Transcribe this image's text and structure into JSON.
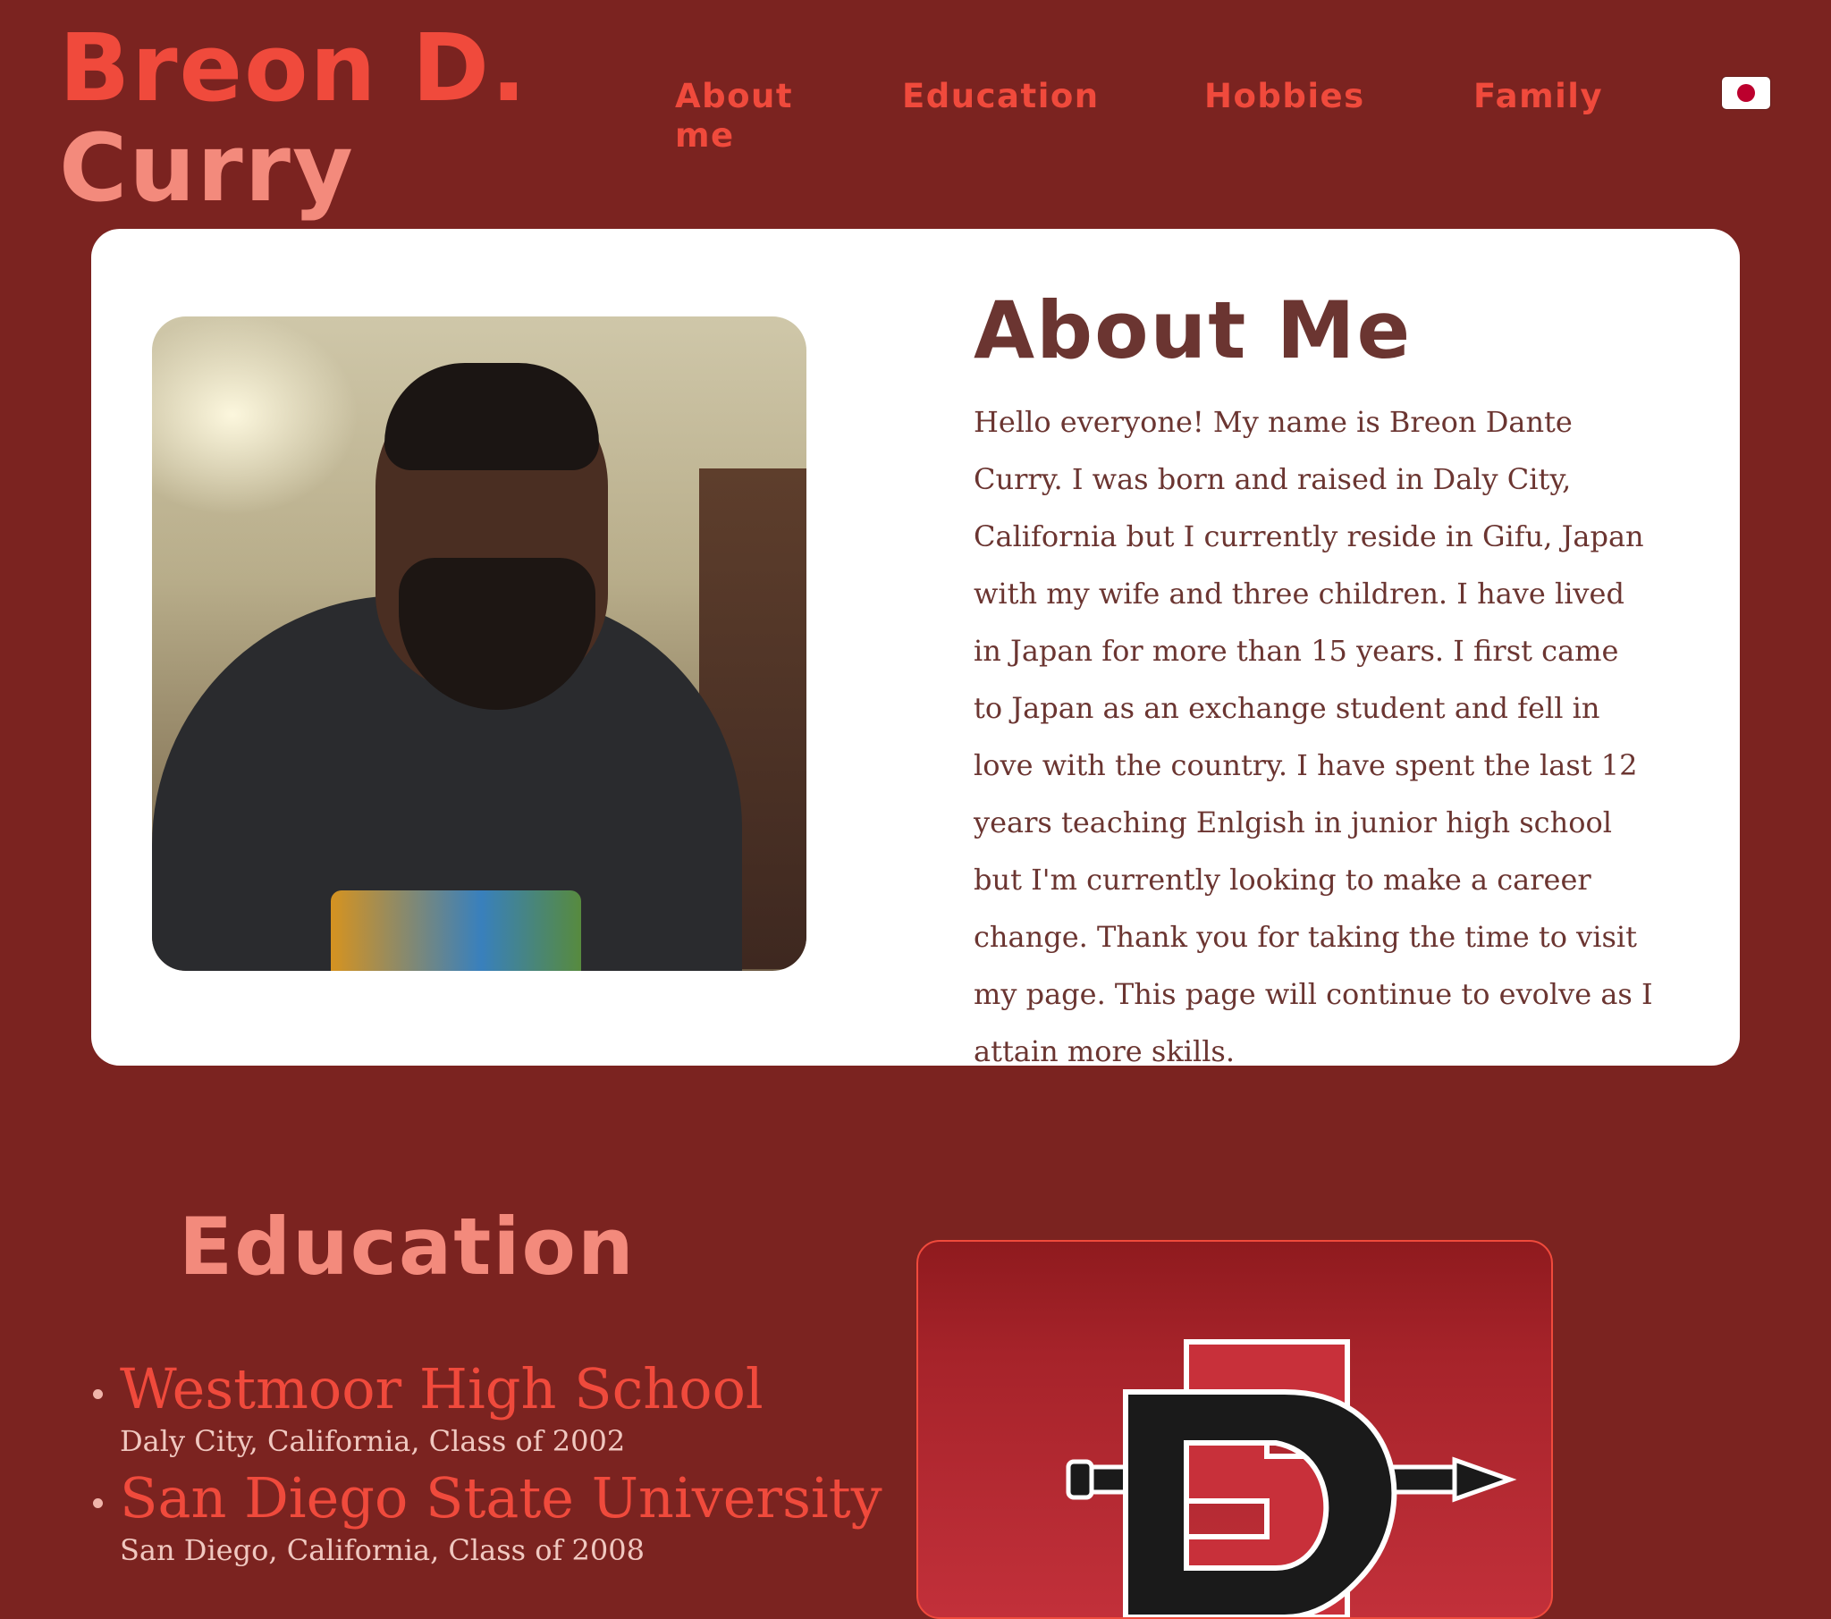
{
  "header": {
    "title_line1": "Breon D.",
    "title_line2": "Curry",
    "nav": [
      {
        "label": "About me"
      },
      {
        "label": "Education"
      },
      {
        "label": "Hobbies"
      },
      {
        "label": "Family"
      }
    ],
    "language_toggle_icon": "japan-flag-icon"
  },
  "about": {
    "heading": "About Me",
    "photo_icon": "profile-photo",
    "paragraph": "Hello everyone! My name is Breon Dante Curry. I was born and raised in Daly City, California but I currently reside in Gifu, Japan with my wife and three children. I have lived in Japan for more than 15 years. I first came to Japan as an exchange student and fell in love with the country. I have spent the last 12 years teaching Enlgish in junior high school but I'm currently looking to make a career change. Thank you for taking the time to visit my page. This page will continue to evolve as I attain more skills."
  },
  "education": {
    "heading": "Education",
    "schools": [
      {
        "name": "Westmoor High School",
        "detail": "Daly City, California, Class of 2002"
      },
      {
        "name": "San Diego State University",
        "detail": "San Diego, California, Class of 2008"
      }
    ],
    "logo_icon": "sdsu-logo"
  },
  "colors": {
    "background": "#7b2320",
    "accent": "#f04a3c",
    "accent_light": "#f38a7c",
    "card": "#ffffff",
    "card_text": "#6b3531"
  }
}
